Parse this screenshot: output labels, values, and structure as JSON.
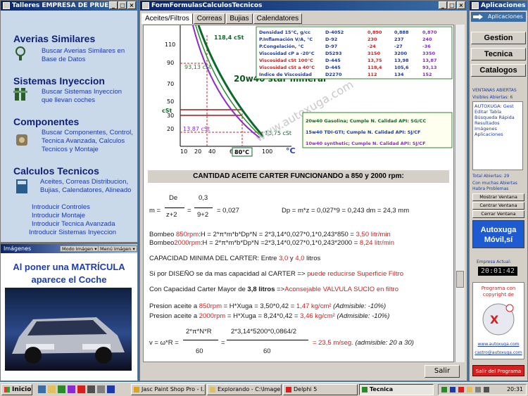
{
  "left_window": {
    "title": "Talleres EMPRESA DE PRUEI",
    "sections": [
      {
        "title": "Averias Similares",
        "text": "Buscar Averias Similares en Base de Datos"
      },
      {
        "title": "Sistemas Inyeccion",
        "text": "Buscar Sistemas Inyeccion que llevan coches"
      },
      {
        "title": "Componentes",
        "text": "Buscar Componentes, Control, Tecnica Avanzada, Calculos Tecnicos y Montaje"
      },
      {
        "title": "Calculos Tecnicos",
        "text": "Aceites, Correas Distribucion, Bujias, Calendatores, Alineado"
      }
    ],
    "links": [
      "Introducir Controles",
      "Introducir Montaje",
      "Introducir Tecnica Avanzada",
      "Introducir Sistemas Inyeccion"
    ]
  },
  "images_window": {
    "title": "Imágenes",
    "mode_label": "Modo Imágen",
    "menu_label": "Menú Imágen",
    "headline": "Al poner una MATRÍCULA aparece el Coche"
  },
  "main_window": {
    "title": "FormFormulasCalculosTecnicos",
    "tabs": [
      "Aceites/Filtros",
      "Correas",
      "Bujias",
      "Calendatores"
    ],
    "graph": {
      "y_ticks": [
        "110",
        "90",
        "70",
        "50",
        "30",
        "20"
      ],
      "x_ticks": [
        "10",
        "20",
        "40",
        "60",
        "80",
        "100"
      ],
      "label_1184": "118,4 cSt",
      "label_9313": "93,13 cSt",
      "label_1387": "13,87 cSt",
      "label_1375": "13,75 cSt",
      "label_cst": "cSt",
      "label_80c": "80°C",
      "unit_c": "°C",
      "oil_name": "20w40 star mineral",
      "watermark": "www.autoxuga.com",
      "table_rows": [
        [
          "Densidad 15°C, g/cc",
          "D-4052",
          "0,890",
          "0,888",
          "0,870"
        ],
        [
          "P.Inflamación V/A, °C",
          "D-92",
          "230",
          "237",
          "240"
        ],
        [
          "P.Congelación, °C",
          "D-97",
          "-24",
          "-27",
          "-36"
        ],
        [
          "Viscosidad cP a -20°C",
          "D5293",
          "3150",
          "3200",
          "3350"
        ],
        [
          "Viscosidad cSt 100°C",
          "D-445",
          "13,75",
          "13,98",
          "13,87"
        ],
        [
          "Viscosidad cSt a 40°C",
          "D-445",
          "118,4",
          "105,6",
          "93,13"
        ],
        [
          "Indice de Viscosidad",
          "D2270",
          "112",
          "134",
          "152"
        ]
      ],
      "legend": [
        "20w40 Gasolina; Cumple N. Calidad API: SG/CC",
        "15w40 TDI-GTI; Cumple N. Calidad API: SJ/CF",
        "10w40 synthetic; Cumple N. Calidad API: SJ/CF"
      ]
    },
    "header": "CANTIDAD ACEITE CARTER FUNCIONANDO a 850 y 2000 rpm:",
    "formula_m": {
      "lhs": "m =",
      "num1": "De",
      "den1": "z+2",
      "eq": "=",
      "num2": "0,3",
      "den2": "9+2",
      "result": "= 0,027"
    },
    "formula_dp": "Dp = m*z = 0,027*9 = 0,243 dm = 24,3 mm",
    "bombeo1": {
      "a": "Bombeo ",
      "rpm": "850rpm",
      "b": ":H = 2*π*m*b*Dp*N = 2*3,14*0,027*0,1*0,243*850 = ",
      "res": "3,50 litr/min"
    },
    "bombeo2": {
      "a": "Bombeo",
      "rpm": "2000rpm",
      "b": ":H = 2*π*m*b*Dp*N =2*3,14*0,027*0,1*0,243*2000 = ",
      "res": "8,24 litr/min"
    },
    "capacidad": {
      "a": "CAPACIDAD MINIMA DEL CARTER: Entre ",
      "v1": "3,0",
      "b": " y ",
      "v2": "4,0",
      "c": " litros"
    },
    "diseno": {
      "a": "Si por DISEÑO se da mas capacidad al CARTER => ",
      "b": "puede reducirse Superficie Filtro"
    },
    "carter": {
      "a": "Con Capacidad Carter Mayor de ",
      "b": "3,8 litros",
      "c": " =>",
      "d": "Aconsejable VALVULA SUCIO en filtro"
    },
    "presion1": {
      "a": "Presion aceite a ",
      "rpm": "850rpm",
      "b": " = H*Xuga = 3,50*0,42 = ",
      "res": "1,47 kg/cm²",
      "adm": "(Admisible: -10%)"
    },
    "presion2": {
      "a": "Presion aceite a ",
      "rpm": "2000rpm",
      "b": " = H*Xuga = 8,24*0,42 = ",
      "res": "3,46 kg/cm²",
      "adm": "(Admisible: -10%)"
    },
    "velocidad": {
      "lhs": "v = ω*R =",
      "num1": "2*π*N*R",
      "den1": "60",
      "eq": "=",
      "num2": "2*3,14*5200*0,0864/2",
      "den2": "60",
      "res": "= 23,5 m/seg.",
      "adm": "(admisible: 20 a 30)"
    },
    "salir_label": "Salir"
  },
  "right_panel": {
    "title": "Aplicaciones",
    "apps_label": "Aplicaciones",
    "buttons": [
      "Gestion",
      "Tecnica",
      "Catalogos"
    ],
    "open_windows_title": "VENTANAS ABIERTAS",
    "visibles": "Visibles Abiertas: 6",
    "windows": [
      "AUTOXUGA: Gest",
      "Editar Tabla",
      "Búsqueda Rápida",
      "Resultados",
      "Imágenes",
      "Aplicaciones"
    ],
    "total": "Total Abiertas: 29",
    "warning": "Con muchas Abiertas Habra Problemas",
    "window_buttons": [
      "Mostrar Ventana",
      "Centrar Ventana",
      "Cerrar Ventana"
    ],
    "brand": "Autoxuga Móvil,sí",
    "empresa_label": "Empresa Actual:",
    "clock": "20:01:42",
    "copyright": "Programa con copyright de",
    "url1": "www.autoxuga.com",
    "url2": "castro@autoxuga.com",
    "exit_label": "Salir del Programa"
  },
  "taskbar": {
    "start": "Inicio",
    "tasks": [
      "Jasc Paint Shop Pro - I...",
      "Explorando - C:\\Imagen...",
      "Delphi 5",
      "Tecnica"
    ],
    "time": "20:31"
  }
}
